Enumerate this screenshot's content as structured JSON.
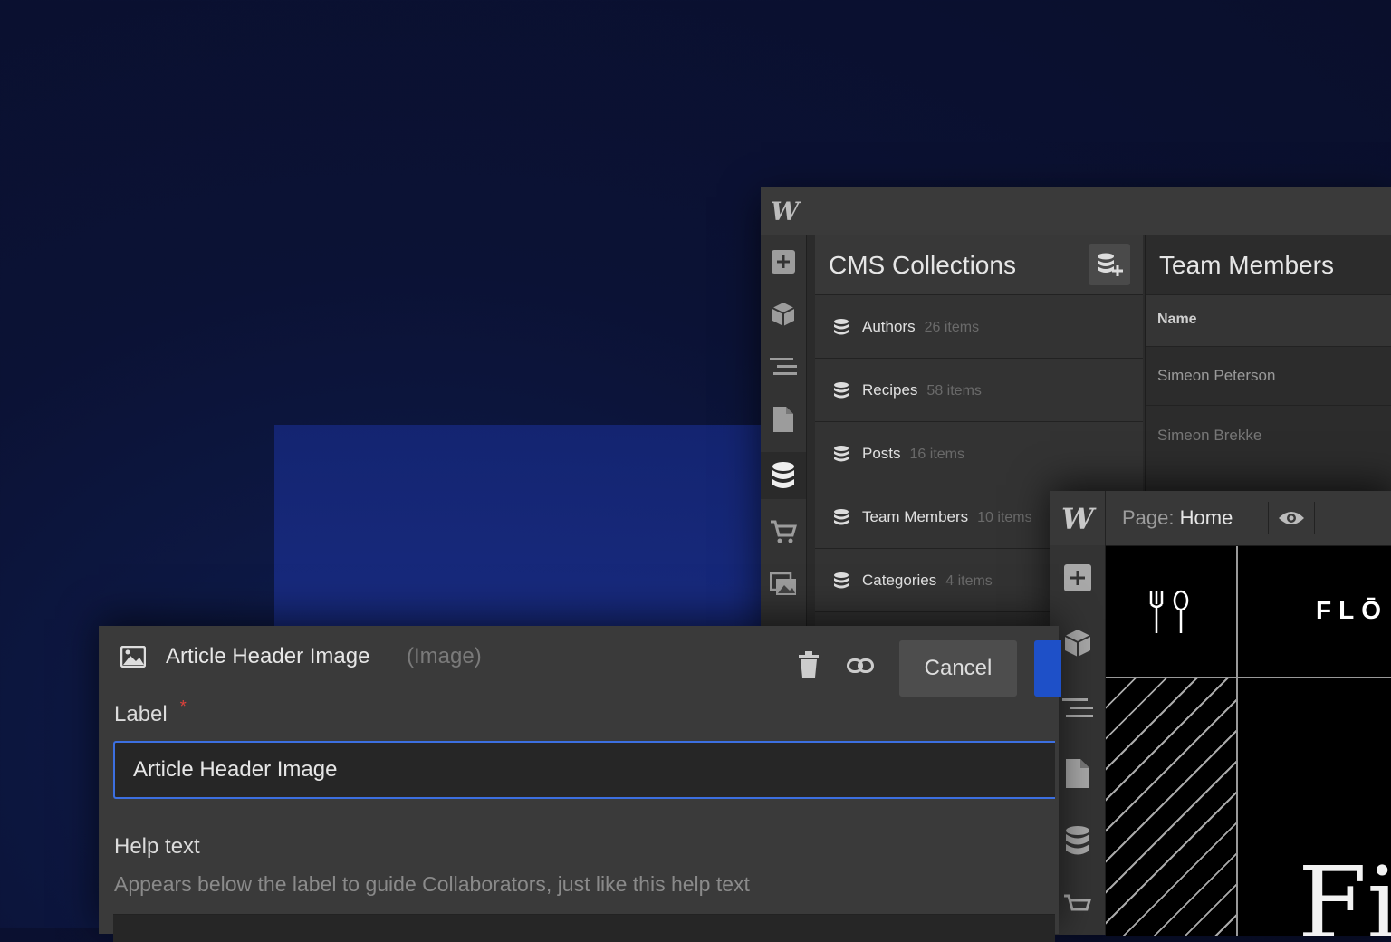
{
  "cms": {
    "title": "CMS Collections",
    "collections": [
      {
        "name": "Authors",
        "count": "26 items"
      },
      {
        "name": "Recipes",
        "count": "58 items"
      },
      {
        "name": "Posts",
        "count": "16 items"
      },
      {
        "name": "Team Members",
        "count": "10 items"
      },
      {
        "name": "Categories",
        "count": "4 items"
      }
    ]
  },
  "team": {
    "title": "Team Members",
    "column": "Name",
    "rows": [
      "Simeon Peterson",
      "Simeon Brekke"
    ]
  },
  "designer": {
    "page_prefix": "Page:",
    "page_name": "Home",
    "brand_text": "FLŌ",
    "heading_text": "Fi"
  },
  "dialog": {
    "title": "Article Header Image",
    "type": "(Image)",
    "cancel_label": "Cancel",
    "label_caption": "Label",
    "required_mark": "*",
    "label_value": "Article Header Image",
    "help_caption": "Help text",
    "help_description": "Appears below the label to guide Collaborators, just like this help text"
  },
  "colors": {
    "accent": "#3c6fe0",
    "required": "#e0413a",
    "primary_button": "#1e50c8"
  }
}
